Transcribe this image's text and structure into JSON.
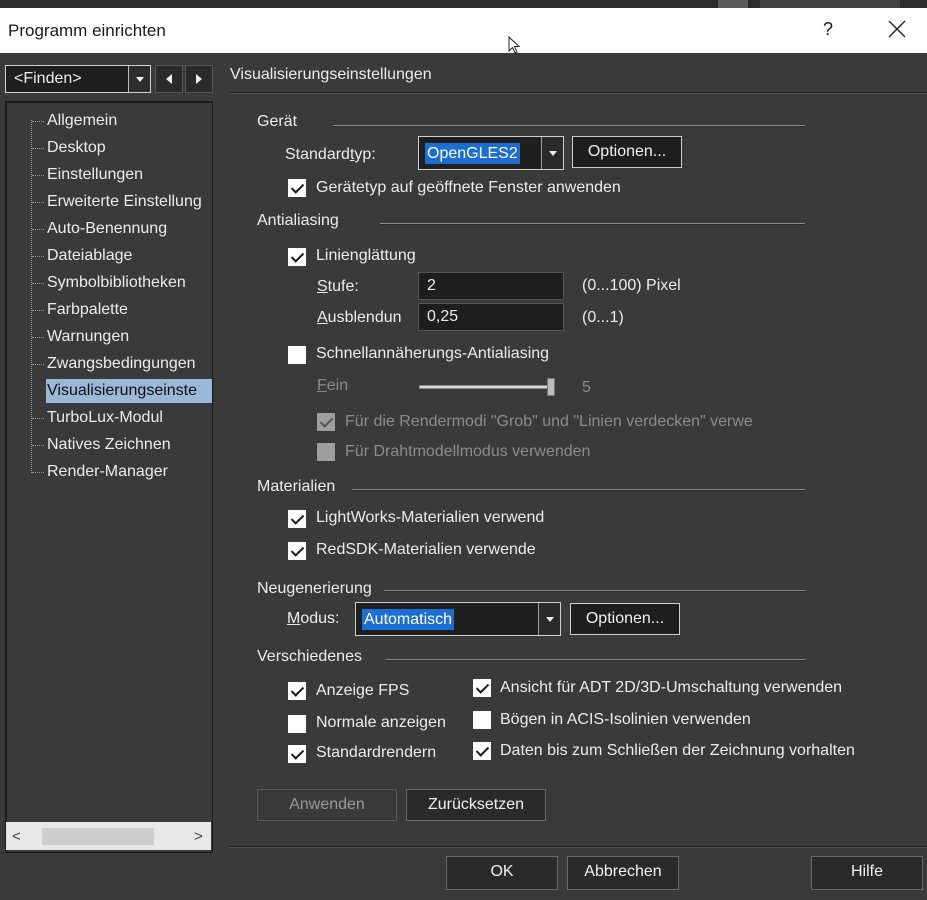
{
  "window": {
    "title": "Programm einrichten",
    "help_label": "?"
  },
  "nav": {
    "find_value": "<Finden>"
  },
  "tree": {
    "items": [
      {
        "label": "Allgemein"
      },
      {
        "label": "Desktop"
      },
      {
        "label": "Einstellungen"
      },
      {
        "label": "Erweiterte Einstellung"
      },
      {
        "label": "Auto-Benennung"
      },
      {
        "label": "Dateiablage"
      },
      {
        "label": "Symbolbibliotheken"
      },
      {
        "label": "Farbpalette"
      },
      {
        "label": "Warnungen"
      },
      {
        "label": "Zwangsbedingungen"
      },
      {
        "label": "Visualisierungseinste",
        "selected": true
      },
      {
        "label": "TurboLux-Modul"
      },
      {
        "label": "Natives Zeichnen"
      },
      {
        "label": "Render-Manager"
      }
    ]
  },
  "panel": {
    "title": "Visualisierungseinstellungen"
  },
  "geraet": {
    "heading": "Gerät",
    "standardtyp_label_pre": "Standard",
    "standardtyp_label_u": "t",
    "standardtyp_label_post": "yp:",
    "standardtyp_value": "OpenGLES2",
    "options_button": "Optionen...",
    "apply_open_label": "Gerätetyp auf geöffnete Fenster anwenden",
    "apply_open_checked": true
  },
  "antialiasing": {
    "heading": "Antialiasing",
    "line_smoothing_label": "Linienglättung",
    "line_smoothing_checked": true,
    "stufe_label_u": "S",
    "stufe_label_rest": "tufe:",
    "stufe_value": "2",
    "stufe_range": "(0...100) Pixel",
    "ausblend_label_u": "A",
    "ausblend_label_rest": "usblendun",
    "ausblend_value": "0,25",
    "ausblend_range": "(0...1)",
    "fast_aa_label": "Schnellannäherungs-Antialiasing",
    "fast_aa_checked": false,
    "fein_label_u": "F",
    "fein_label_rest": "ein",
    "fein_value": "5",
    "fein_level_fraction": 1.0,
    "render_modes_label": "Für die Rendermodi \"Grob\" und \"Linien verdecken\" verwe",
    "render_modes_checked": true,
    "wireframe_label": "Für Drahtmodellmodus verwenden",
    "wireframe_checked": false
  },
  "materialien": {
    "heading": "Materialien",
    "lightworks_label": "LightWorks-Materialien verwend",
    "lightworks_checked": true,
    "redsdk_label": "RedSDK-Materialien verwende",
    "redsdk_checked": true
  },
  "neugenerierung": {
    "heading": "Neugenerierung",
    "modus_label_u": "M",
    "modus_label_rest": "odus:",
    "modus_value": "Automatisch",
    "options_button": "Optionen..."
  },
  "verschiedenes": {
    "heading": "Verschiedenes",
    "fps_label": "Anzeige FPS",
    "fps_checked": true,
    "normals_label": "Normale anzeigen",
    "normals_checked": false,
    "standardrender_label": "Standardrendern",
    "standardrender_checked": true,
    "adt_label": "Ansicht für ADT 2D/3D-Umschaltung verwenden",
    "adt_checked": true,
    "acis_label": "Bögen in ACIS-Isolinien verwenden",
    "acis_checked": false,
    "keep_data_label": "Daten bis zum Schließen der Zeichnung vorhalten",
    "keep_data_checked": true
  },
  "actions": {
    "apply": "Anwenden",
    "reset": "Zurücksetzen",
    "ok": "OK",
    "cancel": "Abbrechen",
    "help": "Hilfe"
  }
}
